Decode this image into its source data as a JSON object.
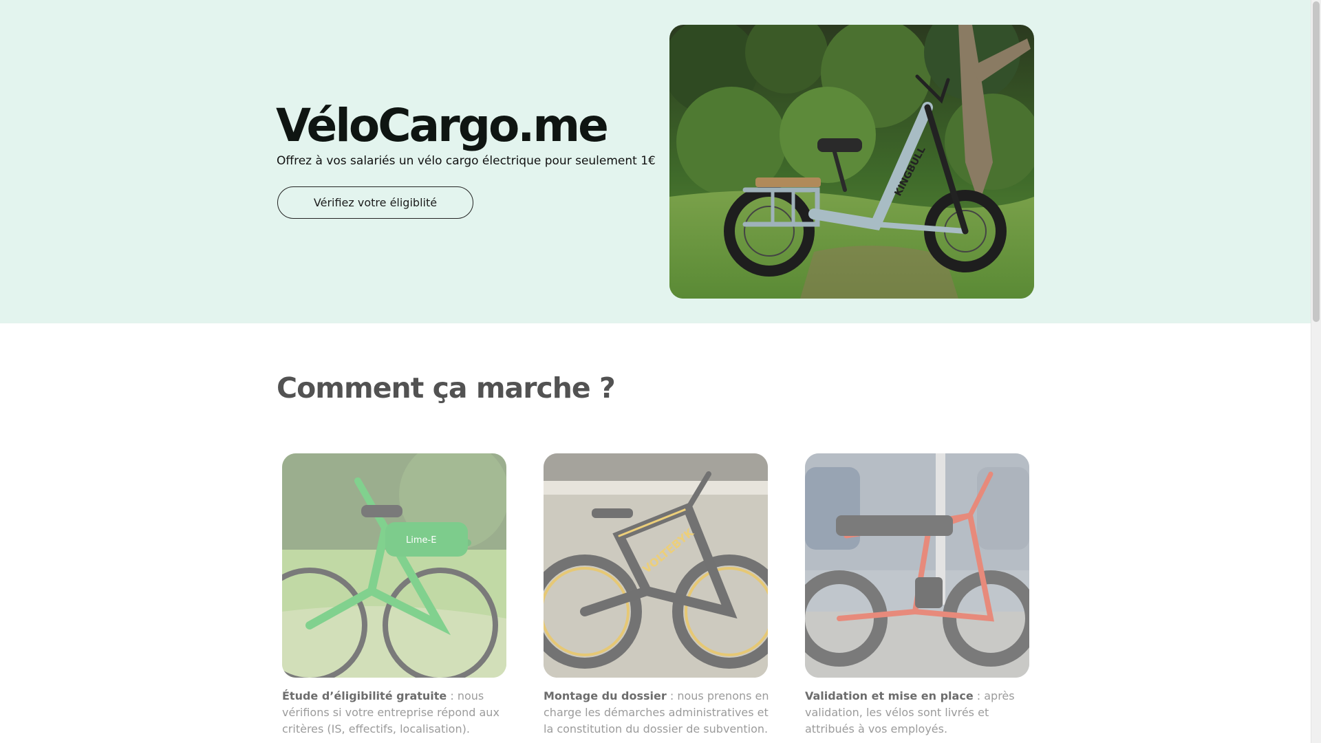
{
  "hero": {
    "title": "VéloCargo.me",
    "subtitle": "Offrez à vos salariés un vélo cargo électrique pour seulement 1€",
    "cta_label": "Vérifiez votre éligiblité",
    "photo_brand_text": "KINGBULL"
  },
  "how_it_works": {
    "title": "Comment ça marche ?",
    "steps": [
      {
        "title": "Étude d’éligibilité gratuite",
        "text": " : nous vérifions si votre entreprise répond aux critères (IS, effectifs, localisation).",
        "photo_text": "Lime-E"
      },
      {
        "title": "Montage du dossier",
        "text": " : nous prenons en charge les démarches administratives et la constitution du dossier de subvention.",
        "photo_text": "VOLTEBYK"
      },
      {
        "title": "Validation et mise en place",
        "text": " : après validation, les vélos sont livrés et attribués à vos employés."
      }
    ]
  },
  "colors": {
    "hero_background": "#e3f4ee",
    "text_dark": "#0f1512",
    "section_title": "#525252",
    "step_text": "#9b9b9b"
  }
}
